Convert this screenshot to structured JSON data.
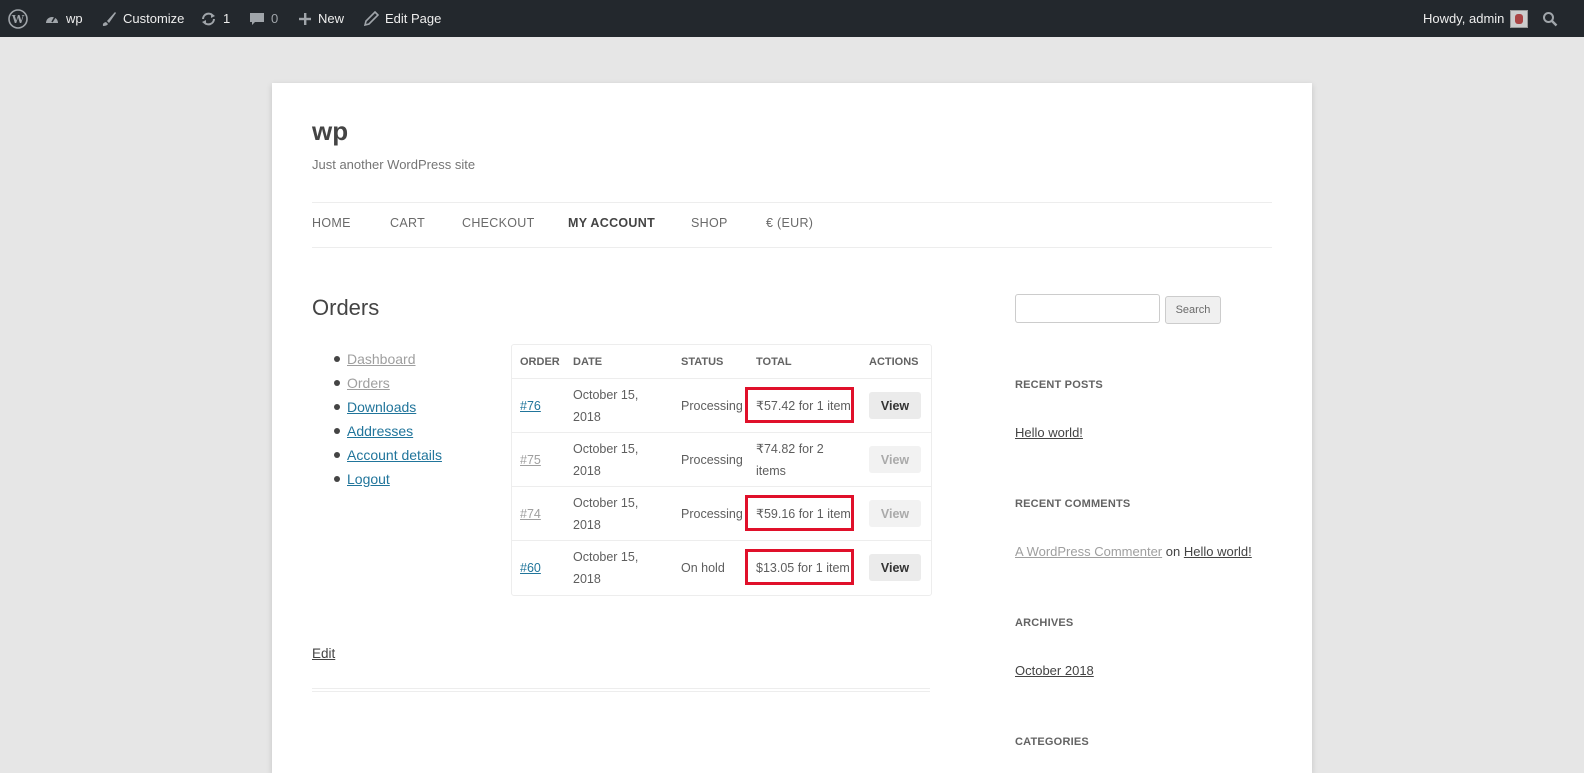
{
  "admin_bar": {
    "site_name": "wp",
    "customize": "Customize",
    "updates_count": "1",
    "comments_count": "0",
    "new_label": "New",
    "edit_page": "Edit Page",
    "howdy": "Howdy, admin"
  },
  "site": {
    "title": "wp",
    "description": "Just another WordPress site"
  },
  "nav": {
    "items": [
      "HOME",
      "CART",
      "CHECKOUT",
      "MY ACCOUNT",
      "SHOP",
      "€ (EUR)"
    ],
    "current": "MY ACCOUNT"
  },
  "page": {
    "title": "Orders",
    "edit_label": "Edit"
  },
  "account_nav": [
    "Dashboard",
    "Orders",
    "Downloads",
    "Addresses",
    "Account details",
    "Logout"
  ],
  "orders_table": {
    "headers": [
      "ORDER",
      "DATE",
      "STATUS",
      "TOTAL",
      "ACTIONS"
    ],
    "rows": [
      {
        "order": "#76",
        "date_line1": "October 15,",
        "date_line2": "2018",
        "status": "Processing",
        "total_line1": "₹57.42 for 1 item",
        "total_line2": "",
        "action": "View",
        "highlighted": true
      },
      {
        "order": "#75",
        "date_line1": "October 15,",
        "date_line2": "2018",
        "status": "Processing",
        "total_line1": "₹74.82 for 2",
        "total_line2": "items",
        "action": "View",
        "highlighted": false
      },
      {
        "order": "#74",
        "date_line1": "October 15,",
        "date_line2": "2018",
        "status": "Processing",
        "total_line1": "₹59.16 for 1 item",
        "total_line2": "",
        "action": "View",
        "highlighted": true
      },
      {
        "order": "#60",
        "date_line1": "October 15,",
        "date_line2": "2018",
        "status": "On hold",
        "total_line1": "$13.05 for 1 item",
        "total_line2": "",
        "action": "View",
        "highlighted": true
      }
    ]
  },
  "sidebar": {
    "search_button": "Search",
    "recent_posts": {
      "title": "RECENT POSTS",
      "items": [
        "Hello world!"
      ]
    },
    "recent_comments": {
      "title": "RECENT COMMENTS",
      "author": "A WordPress Commenter",
      "on": "on",
      "post": "Hello world!"
    },
    "archives": {
      "title": "ARCHIVES",
      "items": [
        "October 2018"
      ]
    },
    "categories": {
      "title": "CATEGORIES"
    }
  },
  "colors": {
    "admin_bar_bg": "#23282d",
    "link": "#21759b",
    "highlight_border": "#e0102a",
    "page_bg": "#e6e6e6"
  }
}
